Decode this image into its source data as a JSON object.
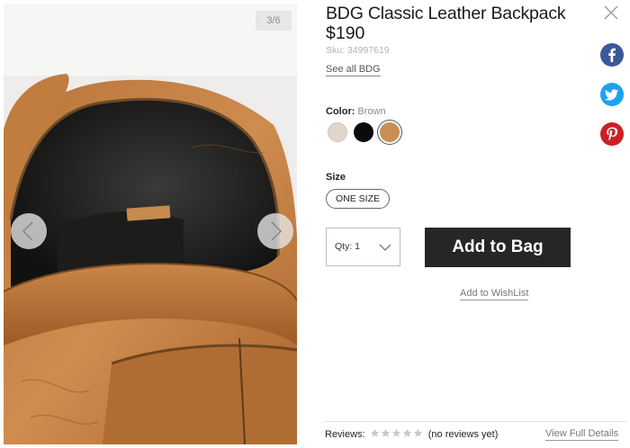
{
  "gallery": {
    "counter": "3/6",
    "image_alt": "BDG Classic Leather Backpack interior view",
    "prev_icon": "chevron-left-icon",
    "next_icon": "chevron-right-icon"
  },
  "product": {
    "title": "BDG Classic Leather Backpack",
    "price": "$190",
    "sku": "Sku: 34997619",
    "see_all": "See all BDG"
  },
  "color": {
    "label": "Color:",
    "selected": "Brown",
    "swatches": [
      {
        "name": "Cream",
        "hex": "#e0d6cc"
      },
      {
        "name": "Black",
        "hex": "#0b0b0b"
      },
      {
        "name": "Brown",
        "hex": "#c98e52"
      }
    ]
  },
  "size": {
    "label": "Size",
    "option": "ONE SIZE"
  },
  "quantity": {
    "label": "Qty: 1"
  },
  "actions": {
    "add_to_bag": "Add to Bag",
    "add_to_wishlist": "Add to WishList"
  },
  "social": [
    {
      "name": "facebook",
      "icon": "facebook-icon",
      "color": "#3b5998"
    },
    {
      "name": "twitter",
      "icon": "twitter-icon",
      "color": "#1da1f2"
    },
    {
      "name": "pinterest",
      "icon": "pinterest-icon",
      "color": "#cb2027"
    }
  ],
  "reviews": {
    "label": "Reviews:",
    "rating": 0,
    "max_rating": 5,
    "count_text": "(no reviews yet)",
    "view_full": "View Full Details"
  }
}
